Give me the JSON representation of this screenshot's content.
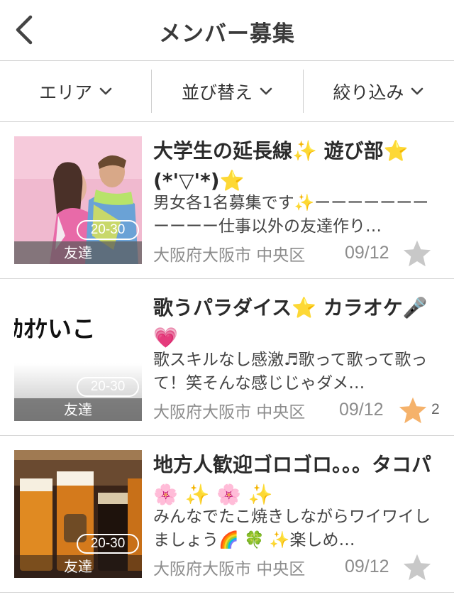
{
  "header": {
    "title": "メンバー募集",
    "back_icon": "chevron-left-icon"
  },
  "filters": [
    {
      "label": "エリア"
    },
    {
      "label": "並び替え"
    },
    {
      "label": "絞り込み"
    }
  ],
  "colors": {
    "star_inactive": "#c8c8c8",
    "star_active": "#f5b26b",
    "divider": "#cfcfcf"
  },
  "items": [
    {
      "title": "大学生の延長線✨ 遊び部⭐ (*'▽'*)⭐",
      "description": "男女各1名募集です✨ーーーーーーーーーーー仕事以外の友達作り…",
      "age_range": "20-30",
      "category": "友達",
      "area": "大阪府大阪市 中央区",
      "date": "09/12",
      "favorited": false,
      "fav_count": ""
    },
    {
      "title": "歌うパラダイス⭐ カラオケ🎤💗",
      "description": "歌スキルなし感激♬歌って歌って歌って！笑そんな感じじゃダメ…",
      "age_range": "20-30",
      "category": "友達",
      "area": "大阪府大阪市 中央区",
      "date": "09/12",
      "favorited": true,
      "fav_count": "2",
      "thumb_text": "ｶｵｹいこ"
    },
    {
      "title": "地方人歓迎ゴロゴロ。。。タコパ🌸 ✨ 🌸 ✨",
      "description": "みんなでたこ焼きしながらワイワイしましょう🌈 🍀 ✨楽しめ…",
      "age_range": "20-30",
      "category": "友達",
      "area": "大阪府大阪市 中央区",
      "date": "09/12",
      "favorited": false,
      "fav_count": ""
    }
  ]
}
